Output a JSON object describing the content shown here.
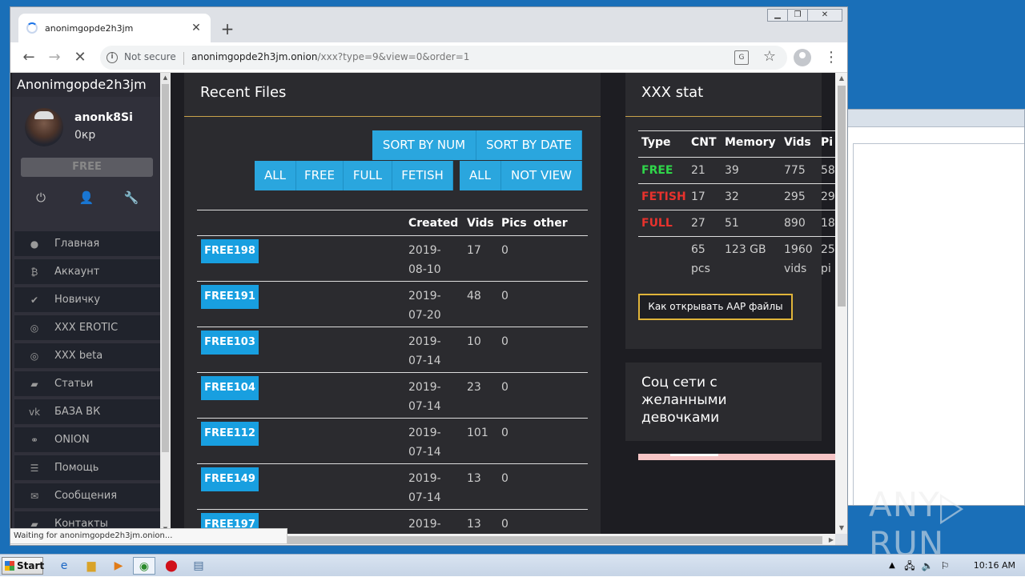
{
  "browser": {
    "tab_title": "anonimgopde2h3jm",
    "not_secure": "Not secure",
    "url_host": "anonimgopde2h3jm.onion",
    "url_rest": "/xxx?type=9&view=0&order=1",
    "status": "Waiting for anonimgopde2h3jm.onion..."
  },
  "sidebar": {
    "brand": "Anonimgopde2h3jm",
    "username": "anonk8Si",
    "balance": "0кр",
    "badge": "FREE",
    "items": [
      {
        "label": "Главная",
        "icon": "●"
      },
      {
        "label": "Аккаунт",
        "icon": "₿"
      },
      {
        "label": "Новичку",
        "icon": "✔"
      },
      {
        "label": "XXX EROTIC",
        "icon": "◎"
      },
      {
        "label": "XXX beta",
        "icon": "◎"
      },
      {
        "label": "Статьи",
        "icon": "▰"
      },
      {
        "label": "БАЗА ВК",
        "icon": "vk"
      },
      {
        "label": "ONION",
        "icon": "⚭"
      },
      {
        "label": "Помощь",
        "icon": "☰"
      },
      {
        "label": "Сообщения",
        "icon": "✉"
      },
      {
        "label": "Контакты",
        "icon": "▰"
      }
    ]
  },
  "recent": {
    "title": "Recent Files",
    "sort_num": "SORT BY NUM",
    "sort_date": "SORT BY DATE",
    "filters": [
      "ALL",
      "FREE",
      "FULL",
      "FETISH"
    ],
    "view_filters": [
      "ALL",
      "NOT VIEW"
    ],
    "columns": [
      "Created",
      "Vids",
      "Pics",
      "other"
    ],
    "rows": [
      {
        "name": "FREE198",
        "date1": "2019-",
        "date2": "08-10",
        "vids": "17",
        "pics": "0"
      },
      {
        "name": "FREE191",
        "date1": "2019-",
        "date2": "07-20",
        "vids": "48",
        "pics": "0"
      },
      {
        "name": "FREE103",
        "date1": "2019-",
        "date2": "07-14",
        "vids": "10",
        "pics": "0"
      },
      {
        "name": "FREE104",
        "date1": "2019-",
        "date2": "07-14",
        "vids": "23",
        "pics": "0"
      },
      {
        "name": "FREE112",
        "date1": "2019-",
        "date2": "07-14",
        "vids": "101",
        "pics": "0"
      },
      {
        "name": "FREE149",
        "date1": "2019-",
        "date2": "07-14",
        "vids": "13",
        "pics": "0"
      },
      {
        "name": "FREE197",
        "date1": "2019-",
        "date2": "",
        "vids": "13",
        "pics": "0"
      }
    ]
  },
  "stat": {
    "title": "XXX stat",
    "columns": [
      "Type",
      "CNT",
      "Memory",
      "Vids",
      "Pi"
    ],
    "rows": [
      {
        "type": "FREE",
        "color": "#2fd64a",
        "cnt": "21",
        "mem": "39",
        "vids": "775",
        "pics": "58"
      },
      {
        "type": "FETISH",
        "color": "#e8322d",
        "cnt": "17",
        "mem": "32",
        "vids": "295",
        "pics": "29"
      },
      {
        "type": "FULL",
        "color": "#e8322d",
        "cnt": "27",
        "mem": "51",
        "vids": "890",
        "pics": "18"
      }
    ],
    "total": {
      "cnt1": "65",
      "cnt2": "pcs",
      "mem": "123 GB",
      "vids1": "1960",
      "vids2": "vids",
      "pics1": "25",
      "pics2": "pi"
    },
    "aap_button": "Как открывать AAP файлы"
  },
  "social": {
    "title": "Соц сети с желанными девочками"
  },
  "watermark": "ANY RUN",
  "taskbar": {
    "start": "Start",
    "time": "10:16 AM"
  }
}
